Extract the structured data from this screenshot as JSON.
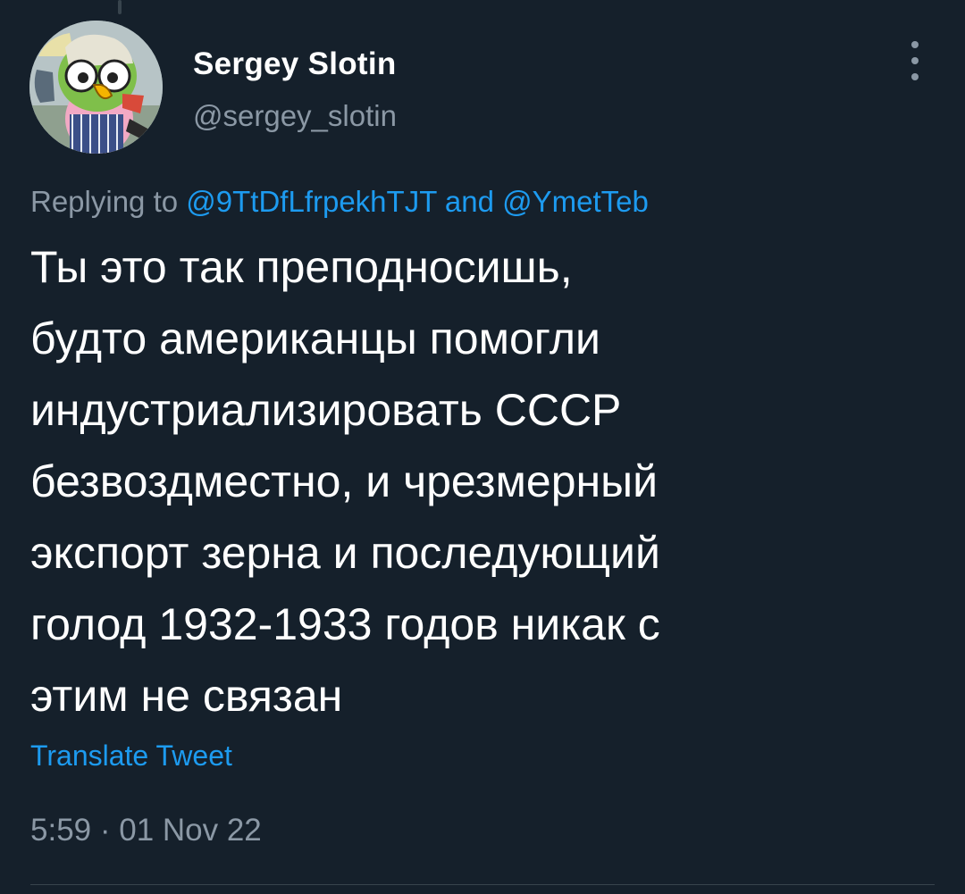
{
  "tweet": {
    "author_name": "Sergey Slotin",
    "author_handle": "@sergey_slotin",
    "replying_to_prefix": "Replying to",
    "reply_mentions": [
      "@9TtDfLfrpekhTJT",
      "@YmetTeb"
    ],
    "reply_conjunction": "and",
    "text": "Ты это так преподносишь,\nбудто американцы помогли\nиндустриализировать СССР\nбезвоздместно, и чрезмерный\nэкспорт зерна и последующий\nголод 1932-1933 годов никак с\nэтим не связан",
    "translate_label": "Translate Tweet",
    "timestamp": "5:59 · 01 Nov 22"
  },
  "icons": {
    "more": "more-vertical-icon",
    "avatar": "cartoon-parrot-avatar"
  },
  "colors": {
    "background": "#15202b",
    "primary_text": "#ffffff",
    "secondary_text": "#8b98a5",
    "accent": "#1d9bf0",
    "divider": "#38444d"
  }
}
